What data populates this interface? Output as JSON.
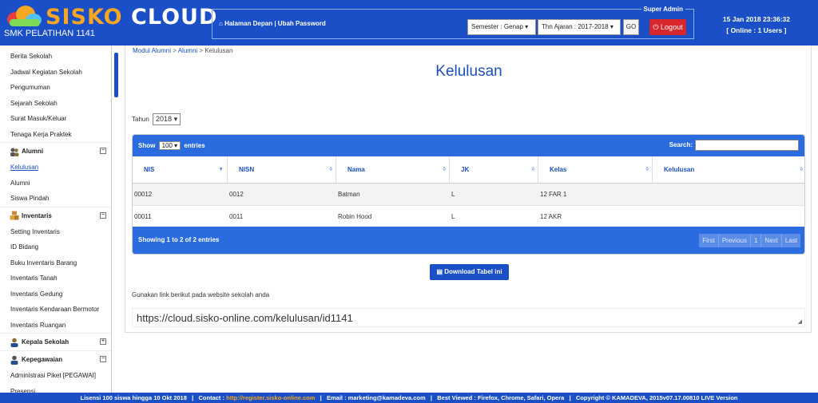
{
  "brand": {
    "word1": "SISKO",
    "word2": "CLOUD",
    "school": "SMK PELATIHAN 1141"
  },
  "header": {
    "links": "Halaman Depan | Ubah Password",
    "role": "Super Admin",
    "semester": "Semester : Genap",
    "year": "Thn Ajaran : 2017-2018",
    "go": "GO",
    "logout": "Logout",
    "datetime": "15 Jan 2018 23:36:32",
    "online": "[ Online : 1 Users ]"
  },
  "sidebar": {
    "top_items": [
      "Berita Sekolah",
      "Jadwal Kegiatan Sekolah",
      "Pengumuman",
      "Sejarah Sekolah",
      "Surat Masuk/Keluar",
      "Tenaga Kerja Praktek"
    ],
    "alumni": {
      "label": "Alumni",
      "items": [
        "Kelulusan",
        "Alumni",
        "Siswa Pindah"
      ]
    },
    "inventaris": {
      "label": "Inventaris",
      "items": [
        "Setting Inventaris",
        "ID Bidang",
        "Buku Inventaris Barang",
        "Inventaris Tanah",
        "Inventaris Gedung",
        "Inventaris Kendaraan Bermotor",
        "Inventaris Ruangan"
      ]
    },
    "kepala": {
      "label": "Kepala Sekolah"
    },
    "kepegawaian": {
      "label": "Kepegawaian",
      "items": [
        "Administrasi Piket [PEGAWAI]",
        "Presensi"
      ]
    }
  },
  "breadcrumb": {
    "a": "Modul Alumni",
    "b": "Alumni",
    "c": "Kelulusan",
    "sep": ">"
  },
  "page_title": "Kelulusan",
  "year_filter": {
    "label": "Tahun",
    "value": "2018"
  },
  "table": {
    "show_label": "Show",
    "show_value": "100",
    "entries_label": "entries",
    "search_label": "Search:",
    "columns": [
      "NIS",
      "NISN",
      "Nama",
      "JK",
      "Kelas",
      "Kelulusan"
    ],
    "rows": [
      [
        "00012",
        "0012",
        "Batman",
        "L",
        "12 FAR 1",
        ""
      ],
      [
        "00011",
        "0011",
        "Robin Hood",
        "L",
        "12 AKR",
        ""
      ]
    ],
    "info": "Showing 1 to 2 of 2 entries",
    "pager": [
      "First",
      "Previous",
      "1",
      "Next",
      "Last"
    ]
  },
  "download_label": "Download Tabel ini",
  "link_hint": "Gunakan link berikut pada website sekolah anda",
  "link_url": "https://cloud.sisko-online.com/kelulusan/id1141",
  "footer": {
    "license": "Lisensi 100 siswa hingga 10 Okt 2018",
    "contact_label": "Contact :",
    "contact_url": "http://register.sisko-online.com",
    "email": "Email : marketing@kamadeva.com",
    "best": "Best Viewed : Firefox, Chrome, Safari, Opera",
    "copyright": "Copyright © KAMADEVA, 2015v07.17.00810 LIVE Version"
  },
  "colors": {
    "primary": "#1a4fc7",
    "accent": "#f5a623",
    "logout": "#d9262c"
  }
}
